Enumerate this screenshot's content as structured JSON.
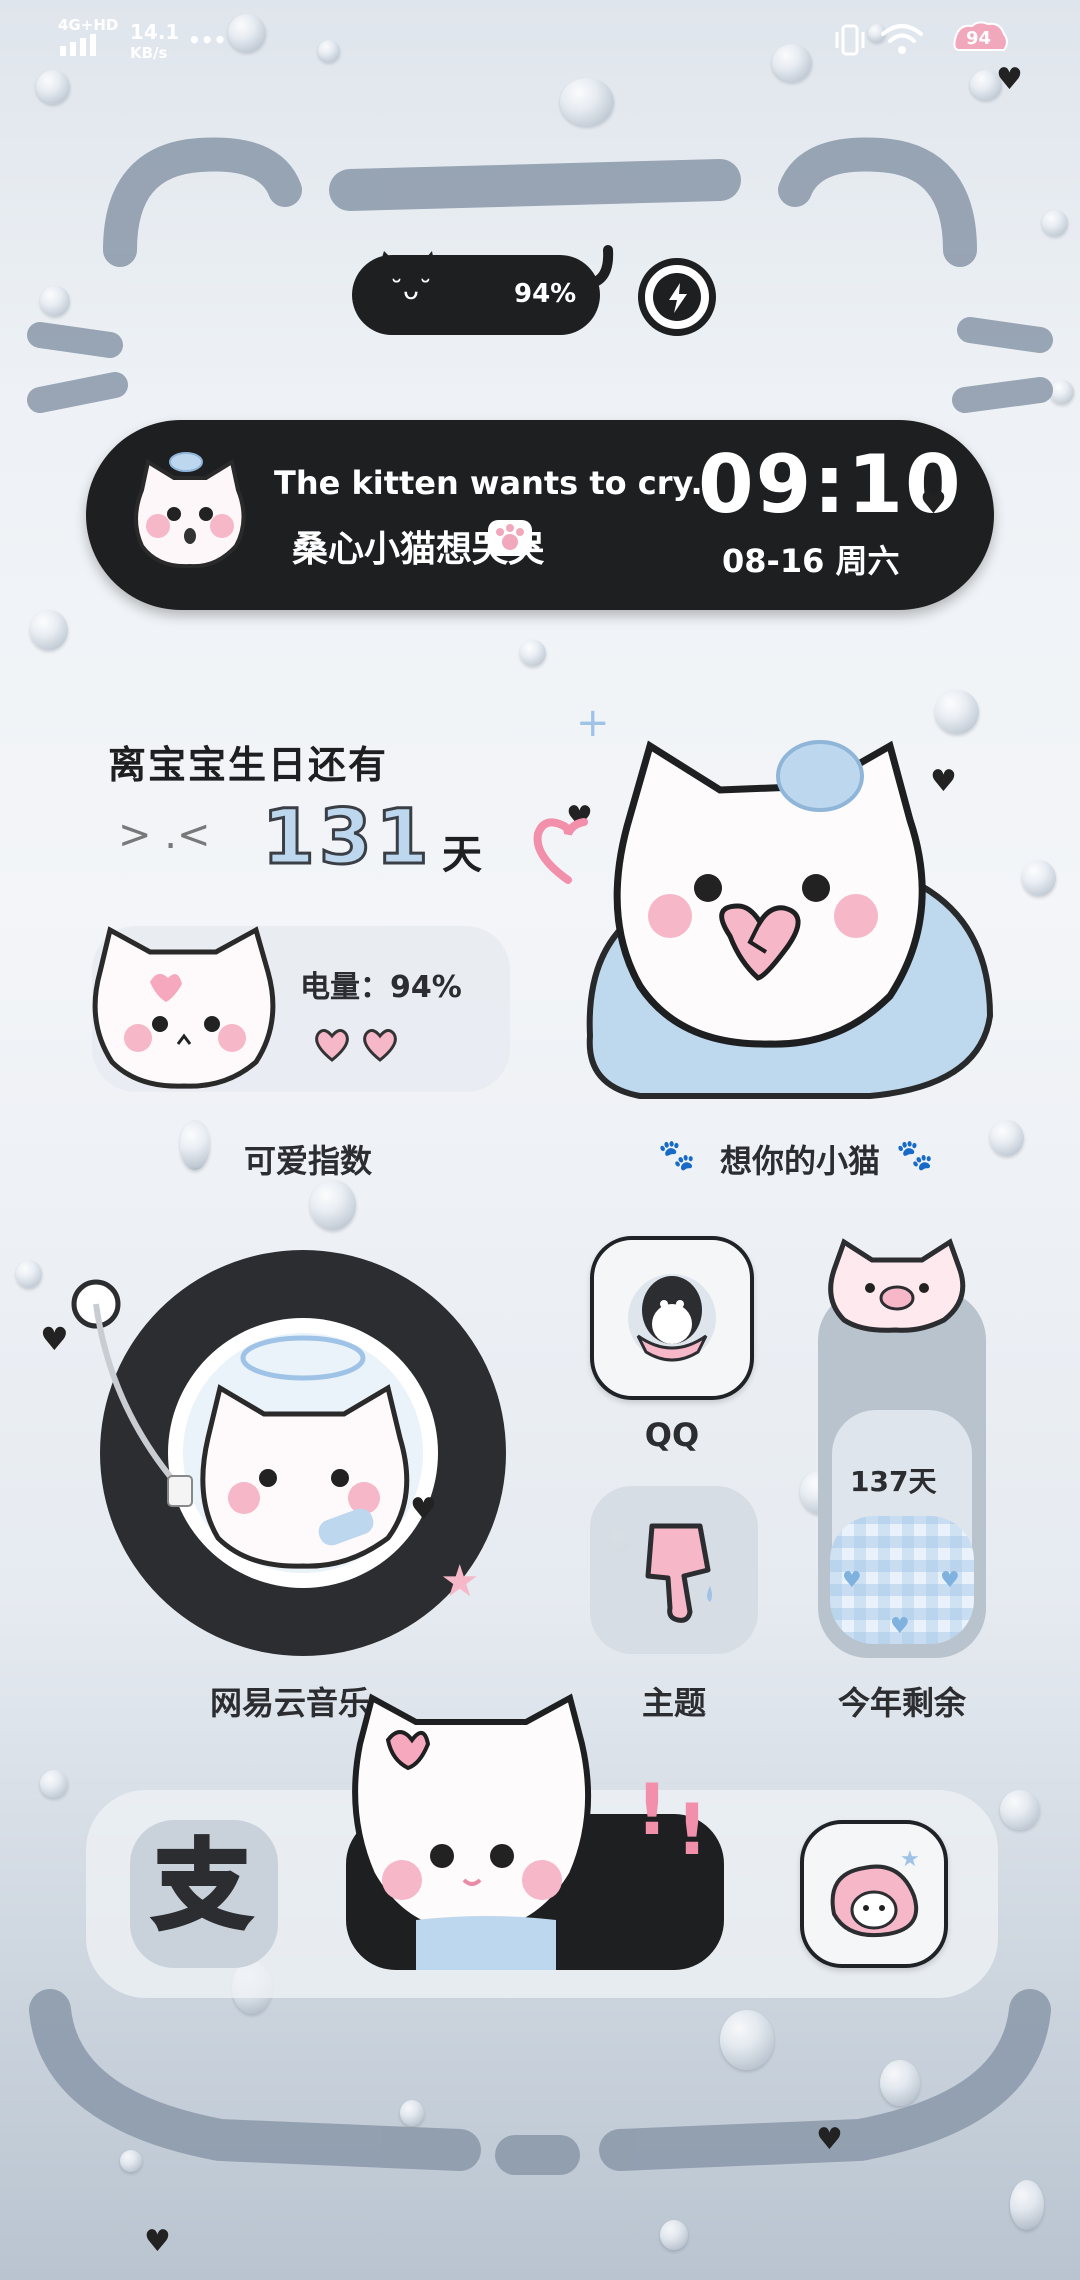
{
  "status_bar": {
    "network": "4G+HD",
    "speed_value": "14.1",
    "speed_unit": "KB/s",
    "more": "•••",
    "battery": "94"
  },
  "battery_pill": {
    "percent": "94%"
  },
  "banner": {
    "title_en": "The kitten wants to cry.",
    "title_cn": "桑心小猫想哭哭",
    "time": "09:10",
    "date": "08-16 周六"
  },
  "birthday": {
    "heading": "离宝宝生日还有",
    "days": "131",
    "unit": "天",
    "emoticon": "> .<"
  },
  "cute_index": {
    "battery_label": "电量：94%",
    "label": "可爱指数"
  },
  "big_cat": {
    "label": "想你的小猫"
  },
  "apps": {
    "music": "网易云音乐",
    "qq": "QQ",
    "theme": "主题",
    "remaining_label": "今年剩余",
    "remaining_days": "137天"
  },
  "dock": {
    "alipay_glyph": "支"
  },
  "colors": {
    "dark": "#1e1f21",
    "frame": "#8796a7",
    "blush": "#f4b7c6",
    "ice": "#bcd7ee"
  }
}
